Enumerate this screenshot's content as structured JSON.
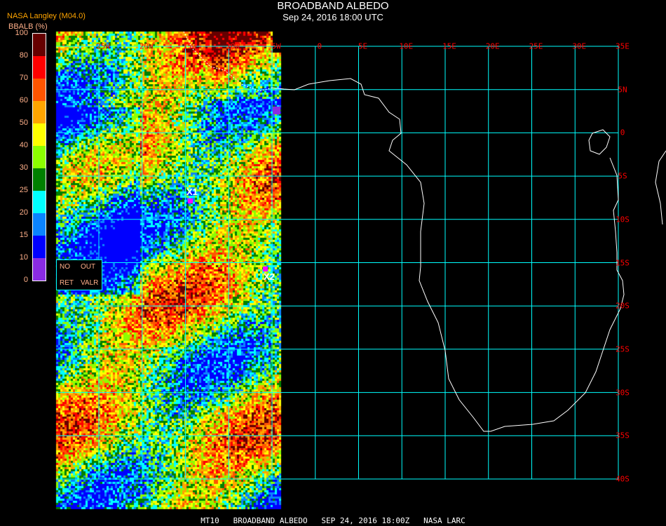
{
  "header": {
    "title": "BROADBAND ALBEDO",
    "subtitle": "Sep 24, 2016 18:00 UTC",
    "credit": "NASA Langley (M04.0)"
  },
  "colorbar": {
    "units": "BBALB (%)",
    "ticks": [
      "0",
      "10",
      "15",
      "20",
      "25",
      "30",
      "40",
      "50",
      "60",
      "70",
      "80",
      "100"
    ],
    "colors": [
      "#8a2be2",
      "#0000ff",
      "#0a84ff",
      "#00ffff",
      "#008000",
      "#8cff00",
      "#ffff00",
      "#ffa500",
      "#ff5500",
      "#ff0000",
      "#660000"
    ]
  },
  "map": {
    "lon_labels": [
      "25W",
      "20W",
      "15W",
      "10W",
      "5W",
      "0",
      "5E",
      "10E",
      "15E",
      "20E",
      "25E",
      "30E",
      "35E"
    ],
    "lat_labels": [
      "5N",
      "0",
      "5S",
      "10S",
      "15S",
      "20S",
      "25S",
      "30S",
      "35S",
      "40S"
    ],
    "grid_color": "#00ffff",
    "coast_color": "#ffffff",
    "markers": [
      {
        "label": "X1"
      },
      {
        "label": "X2"
      }
    ],
    "marker_color": "#ff00ff"
  },
  "legend_box": {
    "no": "NO",
    "out": "OUT",
    "ret": "RET",
    "valr": "VALR"
  },
  "footer": "MT10   BROADBAND ALBEDO   SEP 24, 2016 18:00Z   NASA LARC"
}
